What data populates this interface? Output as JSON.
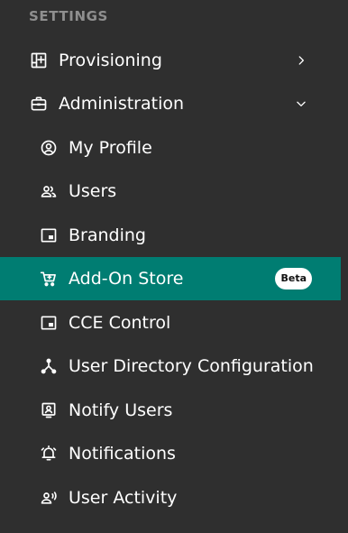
{
  "sidebar": {
    "section_title": "SETTINGS",
    "provisioning": {
      "label": "Provisioning",
      "icon": "grid-plus-icon",
      "state": "collapsed"
    },
    "administration": {
      "label": "Administration",
      "icon": "briefcase-icon",
      "state": "expanded"
    },
    "items": [
      {
        "label": "My Profile",
        "icon": "account-circle-icon"
      },
      {
        "label": "Users",
        "icon": "users-icon"
      },
      {
        "label": "Branding",
        "icon": "branding-icon"
      },
      {
        "label": "Add-On Store",
        "icon": "cart-icon",
        "badge": "Beta",
        "active": true
      },
      {
        "label": "CCE Control",
        "icon": "window-icon"
      },
      {
        "label": "User Directory Configuration",
        "icon": "hierarchy-icon"
      },
      {
        "label": "Notify Users",
        "icon": "notify-user-icon"
      },
      {
        "label": "Notifications",
        "icon": "alarm-bell-icon"
      },
      {
        "label": "User Activity",
        "icon": "user-activity-icon"
      }
    ],
    "colors": {
      "background": "#2f2f2f",
      "active": "#007d72",
      "section_title": "#8f8f8f"
    }
  }
}
